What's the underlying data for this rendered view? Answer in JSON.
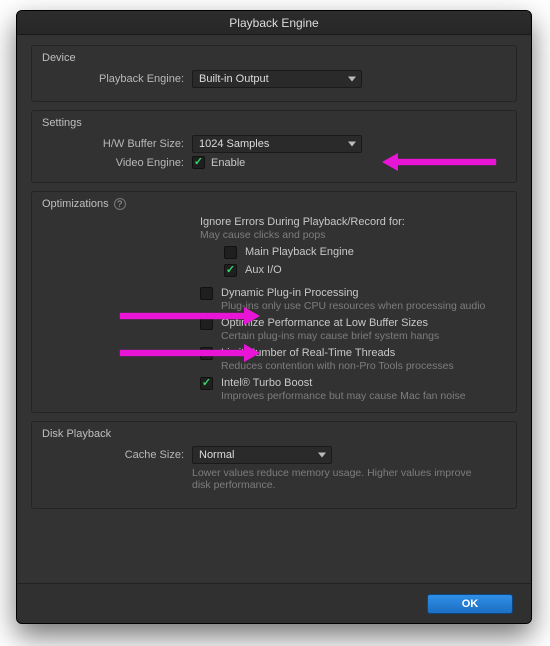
{
  "window": {
    "title": "Playback Engine"
  },
  "device": {
    "section": "Device",
    "playback_engine_label": "Playback Engine:",
    "playback_engine_value": "Built-in Output"
  },
  "settings": {
    "section": "Settings",
    "buffer_label": "H/W Buffer Size:",
    "buffer_value": "1024 Samples",
    "video_label": "Video Engine:",
    "video_enable_label": "Enable",
    "video_enable_checked": true
  },
  "optimizations": {
    "section": "Optimizations",
    "ignore_errors_heading": "Ignore Errors During Playback/Record for:",
    "ignore_errors_hint": "May cause clicks and pops",
    "main_engine_label": "Main Playback Engine",
    "main_engine_checked": false,
    "aux_io_label": "Aux I/O",
    "aux_io_checked": true,
    "dynamic_plugin_label": "Dynamic Plug-in Processing",
    "dynamic_plugin_hint": "Plug-ins only use CPU resources when processing audio",
    "dynamic_plugin_checked": false,
    "optimize_low_buffer_label": "Optimize Performance at Low Buffer Sizes",
    "optimize_low_buffer_hint": "Certain plug-ins may cause brief system hangs",
    "optimize_low_buffer_checked": false,
    "limit_threads_label": "Limit Number of Real-Time Threads",
    "limit_threads_hint": "Reduces contention with non-Pro Tools processes",
    "limit_threads_checked": false,
    "turbo_boost_label": "Intel® Turbo Boost",
    "turbo_boost_hint": "Improves performance but may cause Mac fan noise",
    "turbo_boost_checked": true
  },
  "disk": {
    "section": "Disk Playback",
    "cache_label": "Cache Size:",
    "cache_value": "Normal",
    "cache_hint": "Lower values reduce memory usage. Higher values improve disk performance."
  },
  "footer": {
    "ok_label": "OK"
  }
}
